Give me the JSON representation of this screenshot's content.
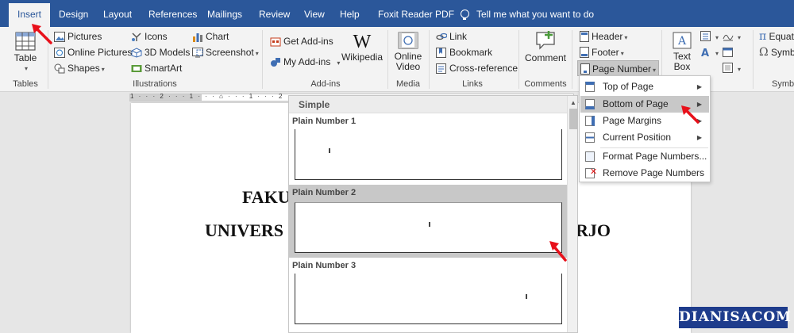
{
  "tabs": [
    {
      "label": "Insert",
      "active": true
    },
    {
      "label": "Design"
    },
    {
      "label": "Layout"
    },
    {
      "label": "References"
    },
    {
      "label": "Mailings"
    },
    {
      "label": "Review"
    },
    {
      "label": "View"
    },
    {
      "label": "Help"
    },
    {
      "label": "Foxit Reader PDF"
    }
  ],
  "tell_me": "Tell me what you want to do",
  "ribbon": {
    "tables": {
      "button": "Table",
      "group": "Tables"
    },
    "illustrations": {
      "pictures": "Pictures",
      "online_pictures": "Online Pictures",
      "shapes": "Shapes",
      "icons": "Icons",
      "models": "3D Models",
      "smartart": "SmartArt",
      "chart": "Chart",
      "screenshot": "Screenshot",
      "group": "Illustrations"
    },
    "addins": {
      "get": "Get Add-ins",
      "my": "My Add-ins",
      "wikipedia": "Wikipedia",
      "group": "Add-ins"
    },
    "media": {
      "video_line1": "Online",
      "video_line2": "Video",
      "group": "Media"
    },
    "links": {
      "link": "Link",
      "bookmark": "Bookmark",
      "cross": "Cross-reference",
      "group": "Links"
    },
    "comments": {
      "comment": "Comment",
      "group": "Comments"
    },
    "header_footer": {
      "header": "Header",
      "footer": "Footer",
      "page_number": "Page Number"
    },
    "text": {
      "textbox_line1": "Text",
      "textbox_line2": "Box"
    },
    "symbols": {
      "equation": "Equati",
      "symbol": "Symbo",
      "group": "Symbo"
    }
  },
  "ruler_marks": "1 · · · 2 · · · 1 · · · ⌂ · · · 1 · · · 2",
  "document": {
    "line1": "FAKU",
    "line2": "UNIVERS",
    "line2_tail": "RJO"
  },
  "gallery": {
    "heading": "Simple",
    "items": [
      {
        "title": "Plain Number 1",
        "selected": false
      },
      {
        "title": "Plain Number 2",
        "selected": true
      },
      {
        "title": "Plain Number 3",
        "selected": false
      }
    ]
  },
  "menu": {
    "items": [
      {
        "label": "Top of Page",
        "submenu": true,
        "icon": "page-top-icon"
      },
      {
        "label": "Bottom of Page",
        "submenu": true,
        "selected": true,
        "icon": "page-bottom-icon"
      },
      {
        "label": "Page Margins",
        "submenu": true,
        "icon": "page-margins-icon"
      },
      {
        "label": "Current Position",
        "submenu": true,
        "icon": "page-current-icon"
      },
      {
        "label": "Format Page Numbers...",
        "submenu": false,
        "icon": "format-page-numbers-icon"
      },
      {
        "label": "Remove Page Numbers",
        "submenu": false,
        "icon": "remove-page-numbers-icon"
      }
    ]
  },
  "watermark": "DIANISACOM",
  "colors": {
    "ribbon_blue": "#2b579a",
    "annotation_red": "#e8101a",
    "watermark_bg": "#1e3c8c"
  }
}
